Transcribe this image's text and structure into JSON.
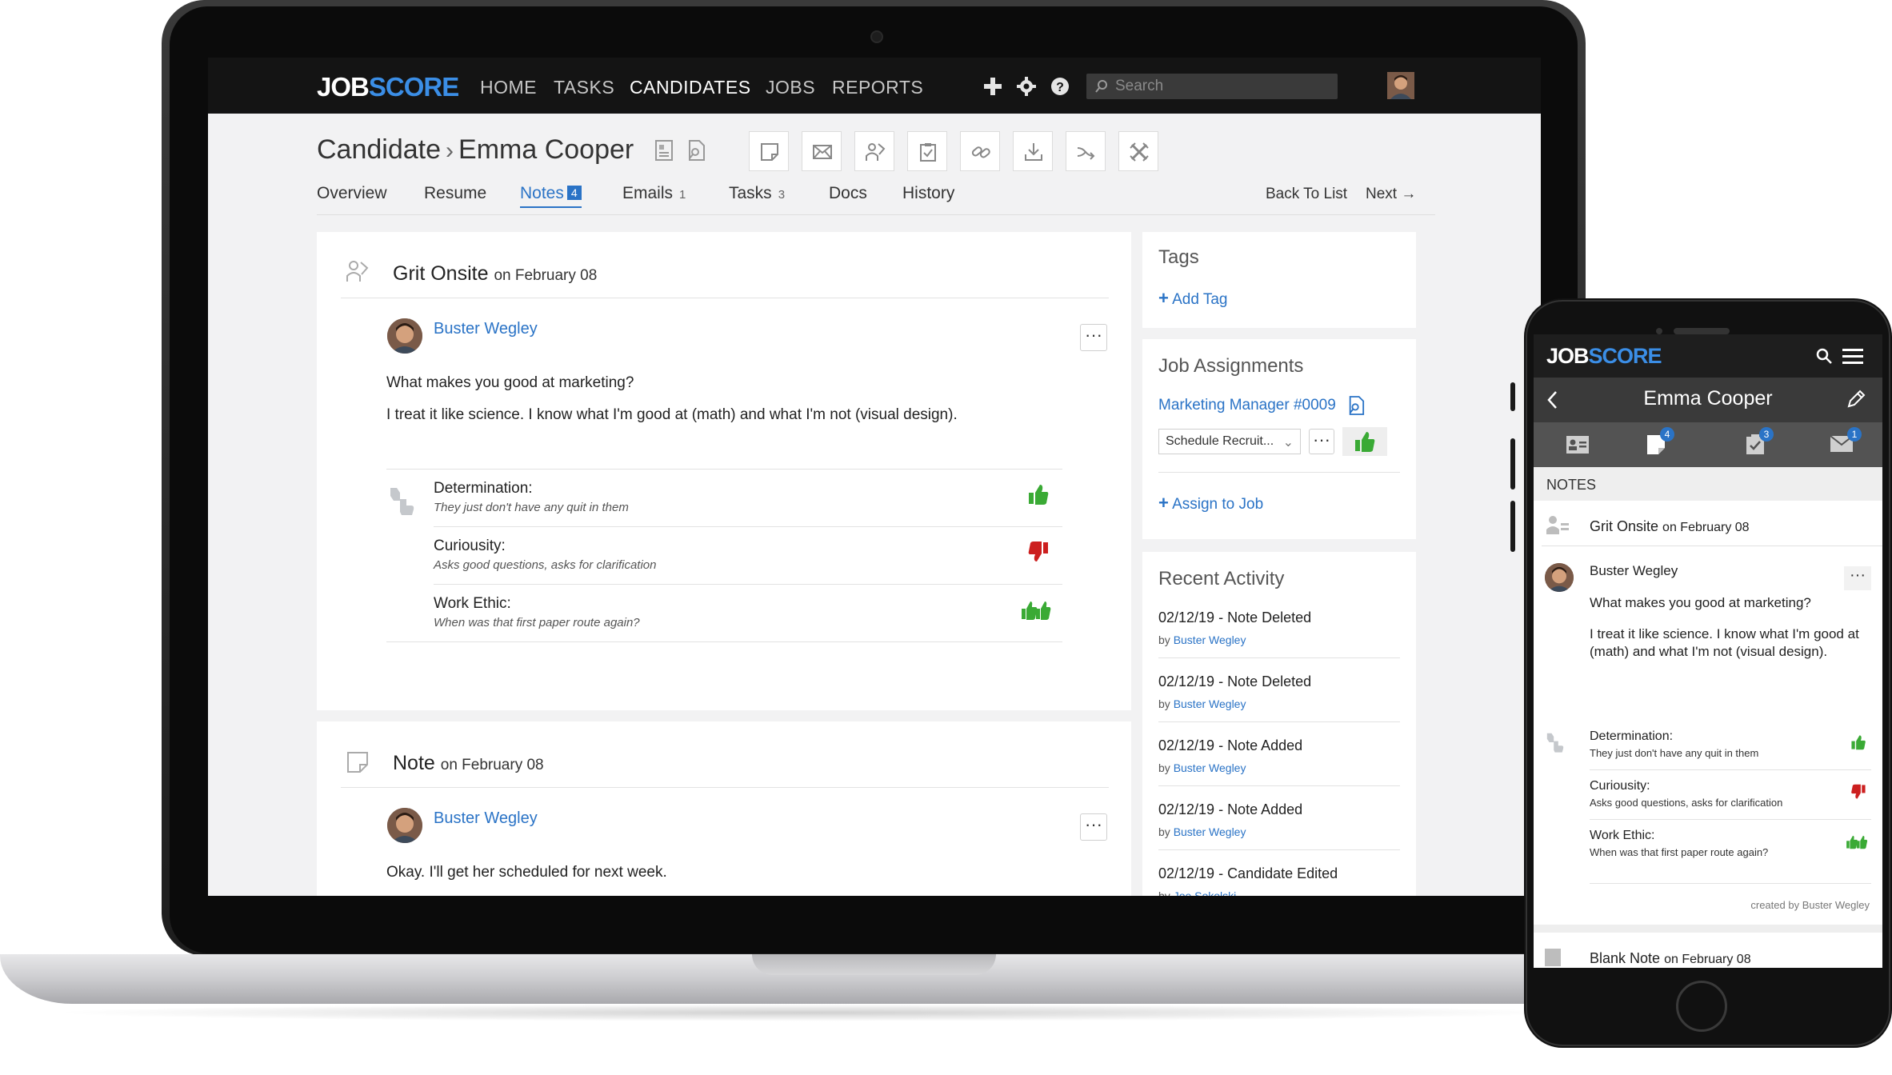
{
  "app": {
    "logo_job": "JOB",
    "logo_score": "SCORE",
    "nav": [
      "HOME",
      "TASKS",
      "CANDIDATES",
      "JOBS",
      "REPORTS"
    ],
    "search_placeholder": "Search"
  },
  "header": {
    "crumb_root": "Candidate",
    "crumb_name": "Emma Cooper",
    "tabs": {
      "overview": "Overview",
      "resume": "Resume",
      "notes": "Notes",
      "notes_badge": "4",
      "emails": "Emails",
      "emails_count": "1",
      "tasks": "Tasks",
      "tasks_count": "3",
      "docs": "Docs",
      "history": "History"
    },
    "back_to_list": "Back To List",
    "next": "Next →"
  },
  "note1": {
    "title": "Grit Onsite",
    "on": "on February 08",
    "author": "Buster Wegley",
    "question": "What makes you good at marketing?",
    "answer": "I treat it like science. I know what I'm good at (math) and what I'm not (visual design).",
    "traits": [
      {
        "title": "Determination:",
        "sub": "They just don't have any quit in them"
      },
      {
        "title": "Curiousity:",
        "sub": "Asks good questions, asks for clarification"
      },
      {
        "title": "Work Ethic:",
        "sub": "When was that first paper route again?"
      }
    ]
  },
  "note2": {
    "title": "Note",
    "on": "on February 08",
    "author": "Buster Wegley",
    "text": "Okay. I'll get her scheduled for next week."
  },
  "sidebar": {
    "tags_title": "Tags",
    "add_tag": "Add Tag",
    "jobs_title": "Job Assignments",
    "job_link": "Marketing Manager #0009",
    "stage_select": "Schedule Recruit...",
    "assign_to_job": "Assign to Job",
    "activity_title": "Recent Activity",
    "activity": [
      {
        "title": "02/12/19 - Note Deleted",
        "by": "by",
        "who": "Buster Wegley"
      },
      {
        "title": "02/12/19 - Note Deleted",
        "by": "by",
        "who": "Buster Wegley"
      },
      {
        "title": "02/12/19 - Note Added",
        "by": "by",
        "who": "Buster Wegley"
      },
      {
        "title": "02/12/19 - Note Added",
        "by": "by",
        "who": "Buster Wegley"
      },
      {
        "title": "02/12/19 - Candidate Edited",
        "by": "by",
        "who": "Joe Sokolski"
      }
    ]
  },
  "mobile": {
    "logo_job": "JOB",
    "logo_score": "SCORE",
    "title": "Emma Cooper",
    "badges": [
      "4",
      "3",
      "1"
    ],
    "section": "NOTES",
    "note_title": "Grit Onsite",
    "note_on": "on February 08",
    "author": "Buster Wegley",
    "question": "What makes you good at marketing?",
    "answer": "I treat it like science. I know what I'm good at (math) and what I'm not (visual design).",
    "traits": [
      {
        "title": "Determination:",
        "sub": "They just don't have any quit in them"
      },
      {
        "title": "Curiousity:",
        "sub": "Asks good questions, asks for clarification"
      },
      {
        "title": "Work Ethic:",
        "sub": "When was that first paper route again?"
      }
    ],
    "created_by": "created by Buster Wegley",
    "blank_title": "Blank Note",
    "blank_on": "on February 08"
  },
  "colors": {
    "accent": "#2a73c6",
    "thumb_up": "#3aaa35",
    "thumb_down": "#cc1f1f",
    "nav_bg": "#141414"
  }
}
